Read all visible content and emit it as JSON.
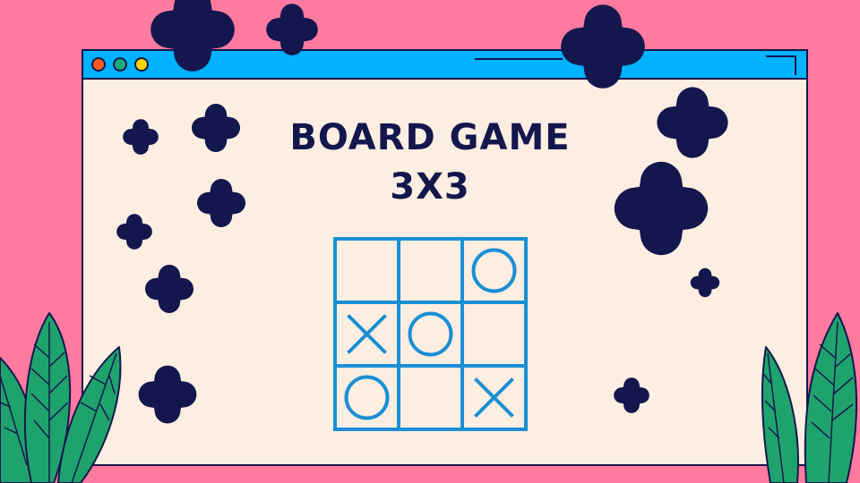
{
  "title": {
    "line1": "BOARD GAME",
    "line2": "3X3"
  },
  "board": {
    "cells": [
      [
        "",
        "",
        "O"
      ],
      [
        "X",
        "O",
        ""
      ],
      [
        "O",
        "",
        "X"
      ]
    ]
  },
  "colors": {
    "background": "#ff7aa0",
    "window": "#fdeee2",
    "titlebar": "#00b2ff",
    "outline": "#14174d",
    "board": "#1a8fd6",
    "dot_red": "#ff5a1f",
    "dot_green": "#1bab7a",
    "dot_yellow": "#ffd400",
    "leaf": "#1fa36d"
  },
  "window_controls": [
    "close-dot",
    "minimize-dot",
    "maximize-dot"
  ]
}
